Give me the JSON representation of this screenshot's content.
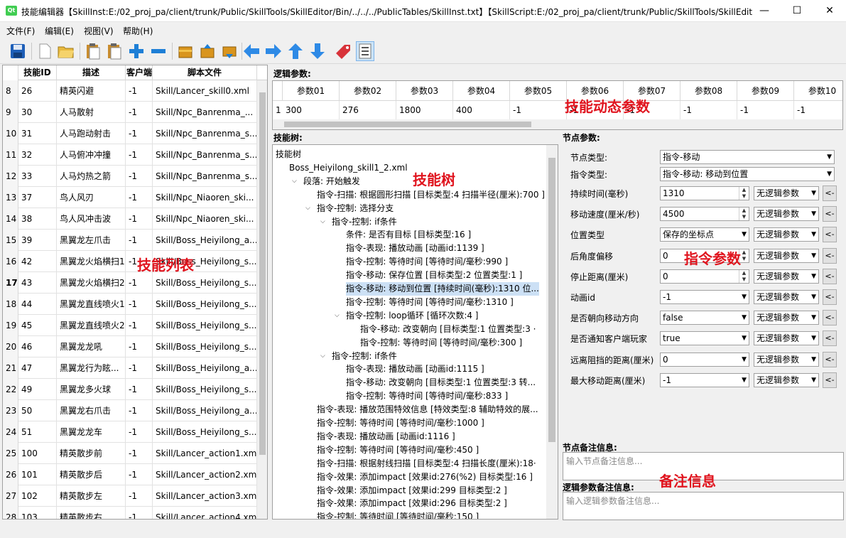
{
  "window": {
    "title": "技能编辑器【SkillInst:E:/02_proj_pa/client/trunk/Public/SkillTools/SkillEditor/Bin/../../../PublicTables/SkillInst.txt】【SkillScript:E:/02_proj_pa/client/trunk/Public/SkillTools/SkillEdit...",
    "app_icon_text": "Qt",
    "minimize": "—",
    "maximize": "☐",
    "close": "✕"
  },
  "menu": [
    "文件(F)",
    "编辑(E)",
    "视图(V)",
    "帮助(H)"
  ],
  "toolbar_icons": [
    "save-icon",
    "new-file-icon",
    "open-folder-icon",
    "paste-icon",
    "paste-copy-icon",
    "plus-icon",
    "minus-icon",
    "box-gold-icon",
    "box-up-icon",
    "box-down-icon",
    "arrow-left-icon",
    "arrow-right-icon",
    "arrow-up-icon",
    "arrow-down-icon",
    "tag-icon",
    "list-icon"
  ],
  "colors": {
    "accent_blue": "#1e7fd6",
    "gold": "#d9951e",
    "red_annotation": "#e0141e",
    "selection": "#cce0f5"
  },
  "annotations": {
    "skill_list": "技能列表",
    "dynamic_params": "技能动态参数",
    "skill_tree": "技能树",
    "command_params": "指令参数",
    "note_info": "备注信息"
  },
  "skill_table": {
    "headers": [
      "技能ID",
      "描述",
      "客户端",
      "脚本文件"
    ],
    "rows": [
      {
        "n": "8",
        "id": "26",
        "desc": "精英闪避",
        "client": "-1",
        "script": "Skill/Lancer_skill0.xml"
      },
      {
        "n": "9",
        "id": "30",
        "desc": "人马散射",
        "client": "-1",
        "script": "Skill/Npc_Banrenma_..."
      },
      {
        "n": "10",
        "id": "31",
        "desc": "人马跑动射击",
        "client": "-1",
        "script": "Skill/Npc_Banrenma_s..."
      },
      {
        "n": "11",
        "id": "32",
        "desc": "人马俯冲冲撞",
        "client": "-1",
        "script": "Skill/Npc_Banrenma_s..."
      },
      {
        "n": "12",
        "id": "33",
        "desc": "人马灼热之箭",
        "client": "-1",
        "script": "Skill/Npc_Banrenma_s..."
      },
      {
        "n": "13",
        "id": "37",
        "desc": "鸟人风刃",
        "client": "-1",
        "script": "Skill/Npc_Niaoren_ski..."
      },
      {
        "n": "14",
        "id": "38",
        "desc": "鸟人风冲击波",
        "client": "-1",
        "script": "Skill/Npc_Niaoren_ski..."
      },
      {
        "n": "15",
        "id": "39",
        "desc": "黑翼龙左爪击",
        "client": "-1",
        "script": "Skill/Boss_Heiyilong_a..."
      },
      {
        "n": "16",
        "id": "42",
        "desc": "黑翼龙火焰横扫1",
        "client": "-1",
        "script": "Skill/Boss_Heiyilong_s..."
      },
      {
        "n": "17",
        "id": "43",
        "desc": "黑翼龙火焰横扫2",
        "client": "-1",
        "script": "Skill/Boss_Heiyilong_s..."
      },
      {
        "n": "18",
        "id": "44",
        "desc": "黑翼龙直线喷火1",
        "client": "-1",
        "script": "Skill/Boss_Heiyilong_s..."
      },
      {
        "n": "19",
        "id": "45",
        "desc": "黑翼龙直线喷火2",
        "client": "-1",
        "script": "Skill/Boss_Heiyilong_s..."
      },
      {
        "n": "20",
        "id": "46",
        "desc": "黑翼龙龙吼",
        "client": "-1",
        "script": "Skill/Boss_Heiyilong_s..."
      },
      {
        "n": "21",
        "id": "47",
        "desc": "黑翼龙行为眩...",
        "client": "-1",
        "script": "Skill/Boss_Heiyilong_a..."
      },
      {
        "n": "22",
        "id": "49",
        "desc": "黑翼龙多火球",
        "client": "-1",
        "script": "Skill/Boss_Heiyilong_s..."
      },
      {
        "n": "23",
        "id": "50",
        "desc": "黑翼龙右爪击",
        "client": "-1",
        "script": "Skill/Boss_Heiyilong_a..."
      },
      {
        "n": "24",
        "id": "51",
        "desc": "黑翼龙龙车",
        "client": "-1",
        "script": "Skill/Boss_Heiyilong_s..."
      },
      {
        "n": "25",
        "id": "100",
        "desc": "精英散步前",
        "client": "-1",
        "script": "Skill/Lancer_action1.xml"
      },
      {
        "n": "26",
        "id": "101",
        "desc": "精英散步后",
        "client": "-1",
        "script": "Skill/Lancer_action2.xml"
      },
      {
        "n": "27",
        "id": "102",
        "desc": "精英散步左",
        "client": "-1",
        "script": "Skill/Lancer_action3.xml"
      },
      {
        "n": "28",
        "id": "103",
        "desc": "精英散步右",
        "client": "-1",
        "script": "Skill/Lancer_action4.xml"
      }
    ]
  },
  "logic_params": {
    "label": "逻辑参数:",
    "headers": [
      "参数01",
      "参数02",
      "参数03",
      "参数04",
      "参数05",
      "参数06",
      "参数07",
      "参数08",
      "参数09",
      "参数10"
    ],
    "row_number": "1",
    "values": [
      "300",
      "276",
      "1800",
      "400",
      "-1",
      "-1",
      "-1",
      "-1",
      "-1",
      "-1"
    ]
  },
  "tree": {
    "label": "技能树:",
    "nodes": [
      {
        "level": 0,
        "arrow": "",
        "text": "技能树"
      },
      {
        "level": 0,
        "arrow": "open",
        "text": "Boss_Heiyilong_skill1_2.xml"
      },
      {
        "level": 1,
        "arrow": "open",
        "text": "段落: 开始触发"
      },
      {
        "level": 2,
        "arrow": "",
        "text": "指令-扫描: 根据圆形扫描 [目标类型:4 扫描半径(厘米):700 ]"
      },
      {
        "level": 2,
        "arrow": "open",
        "text": "指令-控制: 选择分支"
      },
      {
        "level": 3,
        "arrow": "open",
        "text": "指令-控制: if条件"
      },
      {
        "level": 4,
        "arrow": "",
        "text": "条件: 是否有目标 [目标类型:16 ]"
      },
      {
        "level": 4,
        "arrow": "",
        "text": "指令-表现: 播放动画 [动画id:1139 ]"
      },
      {
        "level": 4,
        "arrow": "",
        "text": "指令-控制: 等待时间 [等待时间/毫秒:990 ]"
      },
      {
        "level": 4,
        "arrow": "",
        "text": "指令-移动: 保存位置 [目标类型:2 位置类型:1 ]"
      },
      {
        "level": 4,
        "arrow": "",
        "text": "指令-移动: 移动到位置 [持续时间(毫秒):1310 位...",
        "selected": true
      },
      {
        "level": 4,
        "arrow": "",
        "text": "指令-控制: 等待时间 [等待时间/毫秒:1310 ]"
      },
      {
        "level": 4,
        "arrow": "open",
        "text": "指令-控制: loop循环 [循环次数:4 ]"
      },
      {
        "level": 5,
        "arrow": "",
        "text": "指令-移动: 改变朝向 [目标类型:1 位置类型:3 ·"
      },
      {
        "level": 5,
        "arrow": "",
        "text": "指令-控制: 等待时间 [等待时间/毫秒:300 ]"
      },
      {
        "level": 3,
        "arrow": "open",
        "text": "指令-控制: if条件"
      },
      {
        "level": 4,
        "arrow": "",
        "text": "指令-表现: 播放动画 [动画id:1115 ]"
      },
      {
        "level": 4,
        "arrow": "",
        "text": "指令-移动: 改变朝向 [目标类型:1 位置类型:3 转..."
      },
      {
        "level": 4,
        "arrow": "",
        "text": "指令-控制: 等待时间 [等待时间/毫秒:833 ]"
      },
      {
        "level": 2,
        "arrow": "",
        "text": "指令-表现: 播放范围特效信息 [特效类型:8 辅助特效的展..."
      },
      {
        "level": 2,
        "arrow": "",
        "text": "指令-控制: 等待时间 [等待时间/毫秒:1000 ]"
      },
      {
        "level": 2,
        "arrow": "",
        "text": "指令-表现: 播放动画 [动画id:1116 ]"
      },
      {
        "level": 2,
        "arrow": "",
        "text": "指令-控制: 等待时间 [等待时间/毫秒:450 ]"
      },
      {
        "level": 2,
        "arrow": "",
        "text": "指令-扫描: 根据射线扫描 [目标类型:4 扫描长度(厘米):18·"
      },
      {
        "level": 2,
        "arrow": "",
        "text": "指令-效果: 添加impact [效果id:276(%2) 目标类型:16 ]"
      },
      {
        "level": 2,
        "arrow": "",
        "text": "指令-效果: 添加impact [效果id:299 目标类型:2 ]"
      },
      {
        "level": 2,
        "arrow": "",
        "text": "指令-效果: 添加impact [效果id:296 目标类型:2 ]"
      },
      {
        "level": 2,
        "arrow": "",
        "text": "指令-控制: 等待时间 [等待时间/毫秒:150 ]"
      }
    ]
  },
  "node_params": {
    "label": "节点参数:",
    "node_type_label": "节点类型:",
    "node_type_value": "指令-移动",
    "cmd_type_label": "指令类型:",
    "cmd_type_value": "指令-移动: 移动到位置",
    "fields": [
      {
        "label": "持续时间(毫秒)",
        "value": "1310",
        "kind": "spin"
      },
      {
        "label": "移动速度(厘米/秒)",
        "value": "4500",
        "kind": "spin"
      },
      {
        "label": "位置类型",
        "value": "保存的坐标点",
        "kind": "combo"
      },
      {
        "label": "后角度偏移",
        "value": "0",
        "kind": "spin"
      },
      {
        "label": "停止距离(厘米)",
        "value": "0",
        "kind": "spin"
      },
      {
        "label": "动画id",
        "value": "-1",
        "kind": "combo"
      },
      {
        "label": "是否朝向移动方向",
        "value": "false",
        "kind": "combo"
      },
      {
        "label": "是否通知客户端玩家",
        "value": "true",
        "kind": "combo"
      },
      {
        "label": "远离阻挡的距离(厘米)",
        "value": "0",
        "kind": "combo"
      },
      {
        "label": "最大移动距离(厘米)",
        "value": "-1",
        "kind": "combo"
      }
    ],
    "logic_param_value": "无逻辑参数",
    "arrow_button": "<-"
  },
  "notes": {
    "node_note_label": "节点备注信息:",
    "node_note_placeholder": "输入节点备注信息...",
    "logic_note_label": "逻辑参数备注信息:",
    "logic_note_placeholder": "输入逻辑参数备注信息..."
  }
}
